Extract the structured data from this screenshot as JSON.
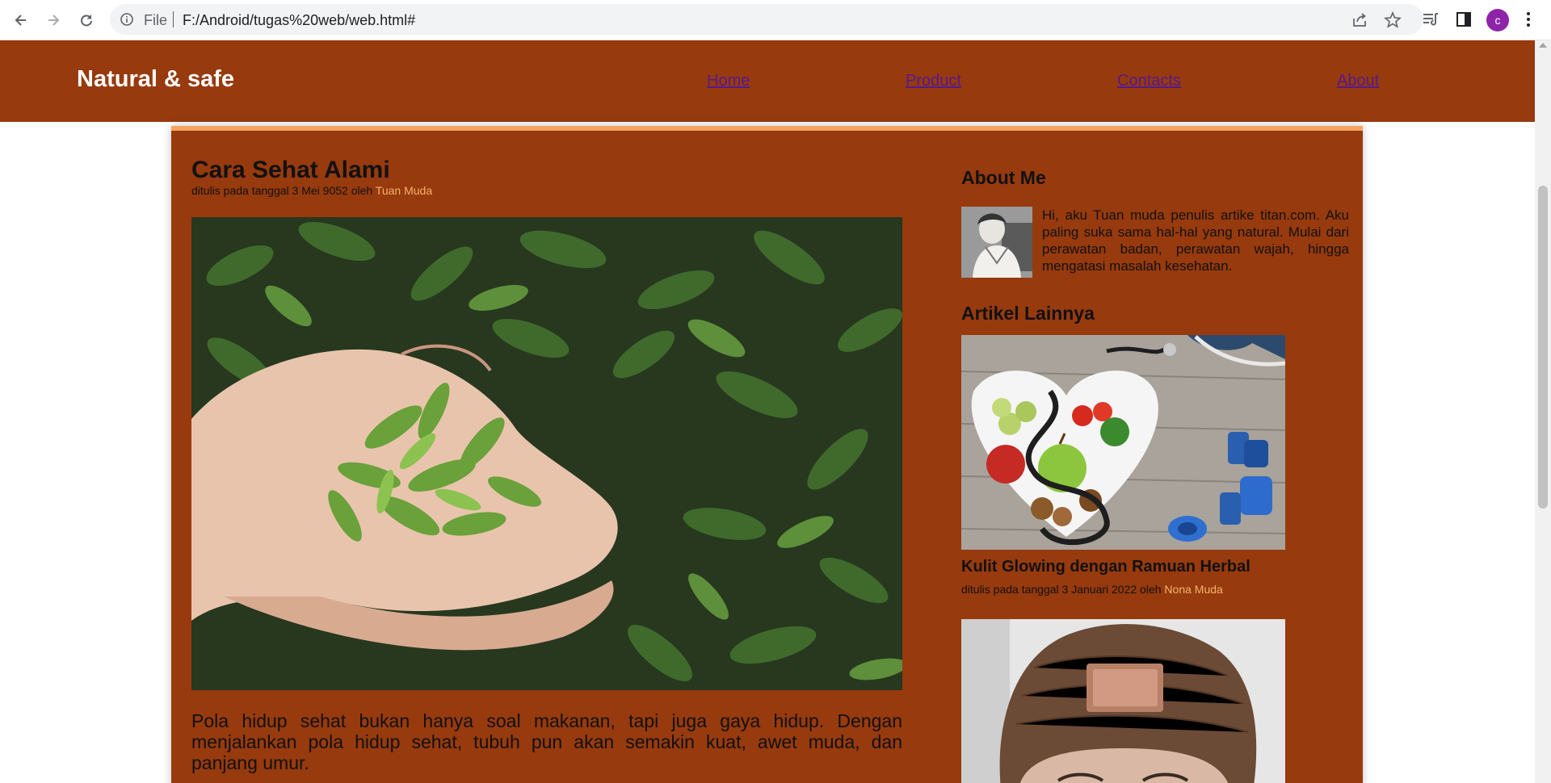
{
  "browser": {
    "scheme": "File",
    "url": "F:/Android/tugas%20web/web.html#",
    "profile_initial": "c",
    "icons": [
      "back-icon",
      "forward-icon",
      "reload-icon",
      "info-icon",
      "share-icon",
      "star-icon",
      "reading-list-icon",
      "side-panel-icon",
      "menu-icon"
    ]
  },
  "site": {
    "brand": "Natural & safe",
    "nav": [
      "Home",
      "Product",
      "Contacts",
      "About"
    ],
    "colors": {
      "header_bg": "#973a0e",
      "accent": "#f4a460",
      "author": "#f6b26b",
      "link": "#551a8b"
    }
  },
  "article": {
    "title": "Cara Sehat Alami",
    "meta_prefix": "ditulis pada tanggal 3 Mei 9052 oleh ",
    "author": "Tuan Muda",
    "body": "Pola hidup sehat bukan hanya soal makanan, tapi juga gaya hidup. Dengan menjalankan pola hidup sehat, tubuh pun akan semakin kuat, awet muda, dan panjang umur."
  },
  "sidebar": {
    "about_heading": "About Me",
    "about_text": "Hi, aku Tuan muda penulis artike titan.com. Aku paling suka sama hal-hal yang natural. Mulai dari perawatan badan, perawatan wajah, hingga mengatasi masalah kesehatan.",
    "others_heading": "Artikel Lainnya",
    "articles": [
      {
        "title": "Kulit Glowing dengan Ramuan Herbal",
        "meta_prefix": "ditulis pada tanggal 3 Januari 2022 oleh ",
        "author": "Nona Muda"
      }
    ]
  }
}
